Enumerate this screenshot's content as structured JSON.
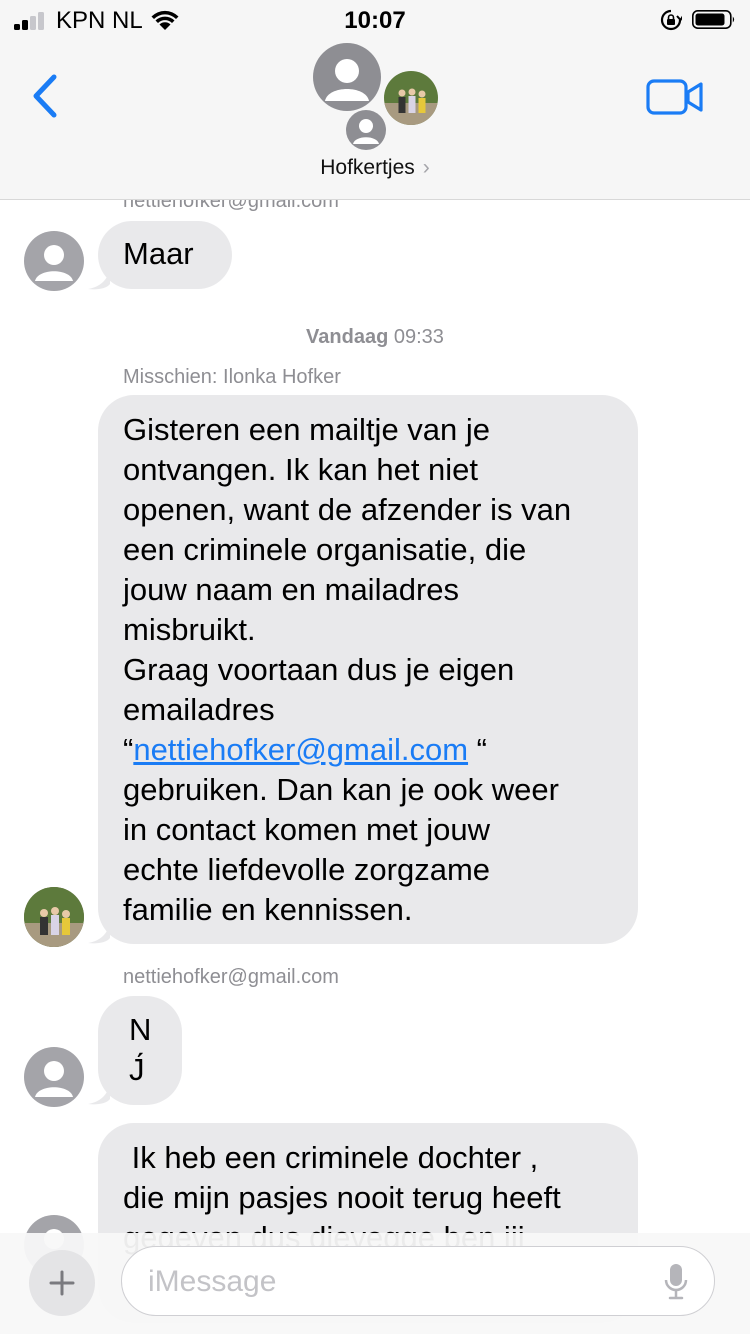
{
  "status_bar": {
    "carrier": "KPN NL",
    "time": "10:07"
  },
  "header": {
    "group_name": "Hofkertjes",
    "chevron": "›",
    "back_icon": "chevron-left-icon",
    "video_icon": "video-camera-icon",
    "accent_color": "#1a7cf5"
  },
  "conversation": {
    "top_partial_sender": "nettiehofker@gmail.com",
    "message_1": {
      "text": "Maar"
    },
    "timestamp": {
      "day": "Vandaag",
      "time": "09:33"
    },
    "sender_2": "Misschien: Ilonka Hofker",
    "message_2": {
      "text_before_link": "Gisteren een mailtje van je\nontvangen. Ik kan het niet\nopenen, want de afzender is van\neen criminele organisatie, die\njouw naam en mailadres\nmisbruikt.\nGraag voortaan dus je eigen\nemailadres\n“",
      "link": "nettiehofker@gmail.com",
      "text_after_link": " “\ngebruiken. Dan kan je ook weer\nin contact komen met jouw\nechte liefdevolle zorgzame\nfamilie en kennissen."
    },
    "sender_3": "nettiehofker@gmail.com",
    "message_3": {
      "text": "N\nJ́"
    },
    "message_4": {
      "text": " Ik heb een criminele dochter ,\ndie mijn pasjes nooit terug heeft\ngegeven dus dievegge ben jij"
    }
  },
  "input_bar": {
    "placeholder": "iMessage",
    "value": ""
  }
}
